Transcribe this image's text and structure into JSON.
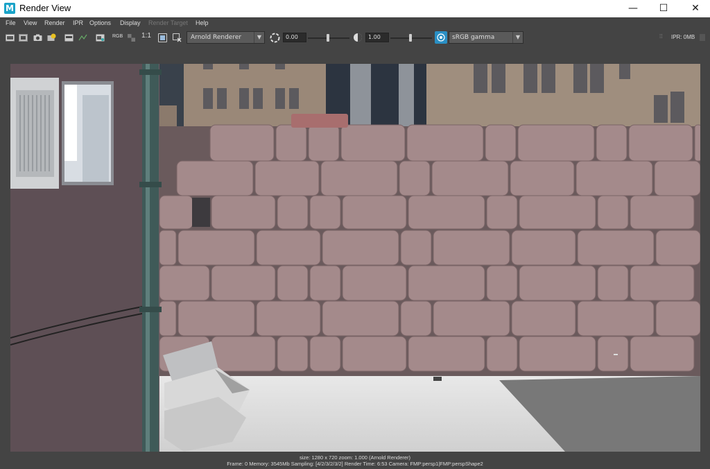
{
  "window": {
    "title": "Render View",
    "app_icon_letter": "M",
    "controls": {
      "minimize": "—",
      "maximize": "☐",
      "close": "✕"
    }
  },
  "menu": {
    "items": [
      {
        "label": "File",
        "enabled": true
      },
      {
        "label": "View",
        "enabled": true
      },
      {
        "label": "Render",
        "enabled": true
      },
      {
        "label": "IPR",
        "enabled": true
      },
      {
        "label": "Options",
        "enabled": true
      },
      {
        "label": "Display",
        "enabled": true
      },
      {
        "label": "Render Target",
        "enabled": false
      },
      {
        "label": "Help",
        "enabled": true
      }
    ]
  },
  "toolbar": {
    "icons": [
      "render-frame-icon",
      "render-region-icon",
      "snapshot-icon",
      "ipr-render-icon",
      "keep-image-icon",
      "remove-image-icon",
      "open-image-icon",
      "rgb-channel-icon",
      "alpha-channel-icon",
      "real-size-icon",
      "color-management-icon",
      "cleanup-icon"
    ],
    "rgb_label": "RGB",
    "one_to_one_label": "1:1",
    "renderer": "Arnold Renderer",
    "exposure_value": "0.00",
    "gamma_value": "1.00",
    "view_transform": "sRGB gamma",
    "ipr_label": "IPR: 0MB",
    "accent": "#2a8fc4"
  },
  "status": {
    "line1": "size: 1280 x 720 zoom: 1.000     (Arnold Renderer)",
    "line2": "Frame: 0     Memory: 3545Mb     Sampling: [4/2/3/2/3/2]     Render Time: 6:53     Camera: FMP:persp1|FMP:perspShape2"
  }
}
